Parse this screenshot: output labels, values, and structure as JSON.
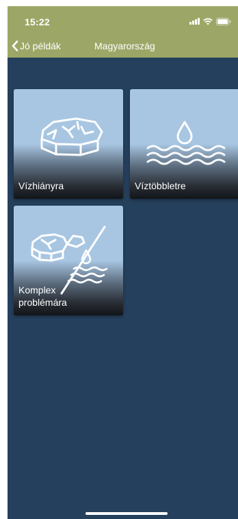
{
  "status_bar": {
    "time": "15:22",
    "icons": [
      "signal-icon",
      "wifi-icon",
      "battery-icon"
    ]
  },
  "nav": {
    "back_label": "Jó példák",
    "title": "Magyarország"
  },
  "colors": {
    "header": "#9ca767",
    "background": "#25405c",
    "tile_top": "#a8c6e2"
  },
  "tiles": [
    {
      "label": "Vízhiányra",
      "icon": "dry-land-icon"
    },
    {
      "label": "Víztöbbletre",
      "icon": "water-drop-waves-icon"
    },
    {
      "label": "Komplex\nproblémára",
      "icon": "complex-problem-icon"
    }
  ]
}
